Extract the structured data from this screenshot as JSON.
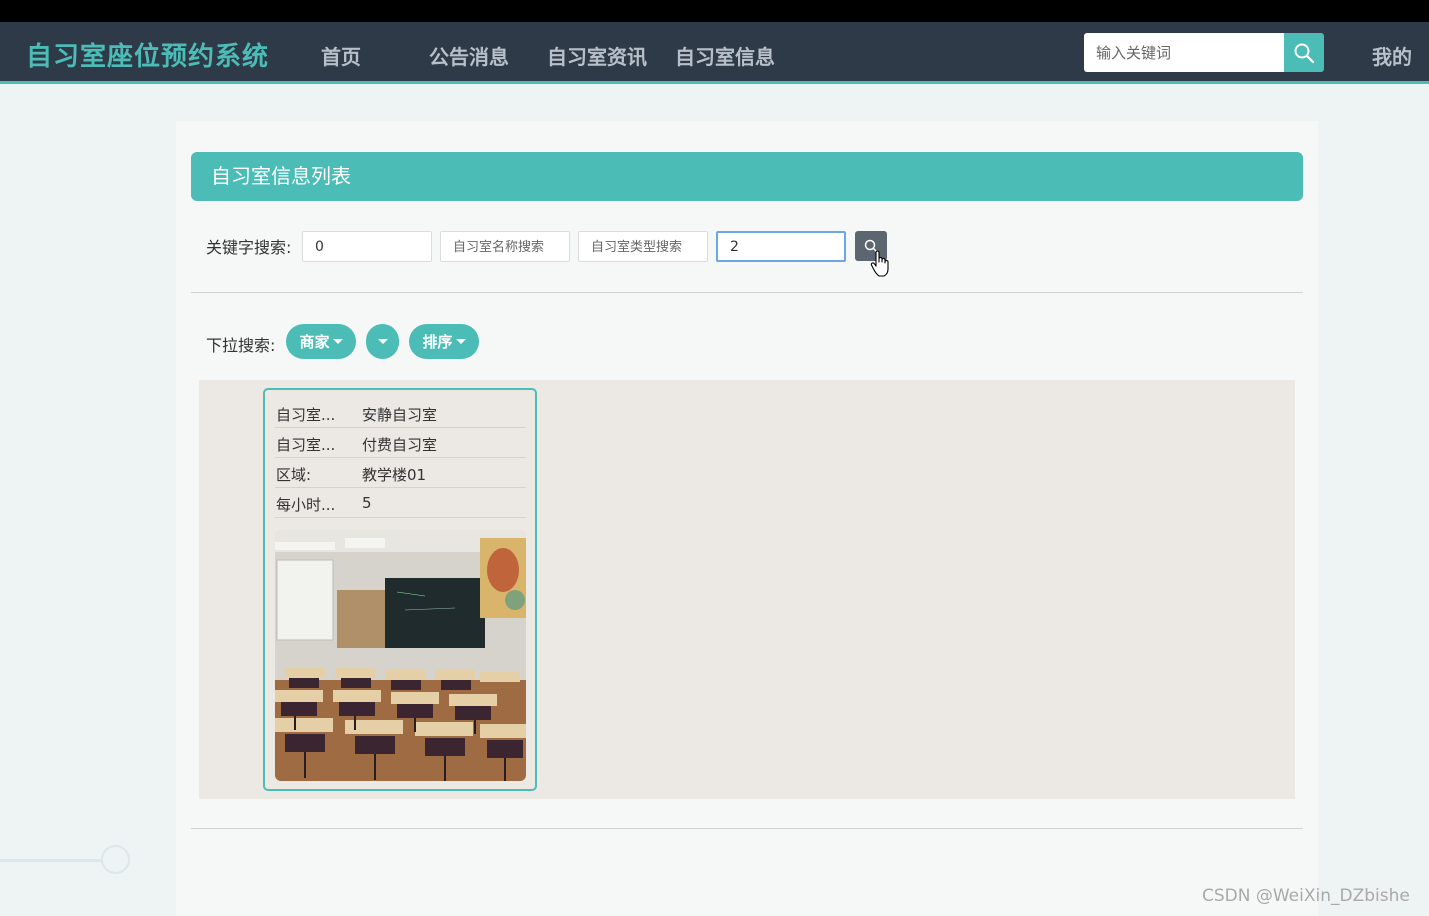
{
  "navbar": {
    "brand": "自习室座位预约系统",
    "links": [
      "首页",
      "公告消息",
      "自习室资讯",
      "自习室信息"
    ],
    "search_placeholder": "输入关键词",
    "mine": "我的"
  },
  "panel": {
    "title": "自习室信息列表",
    "search": {
      "label": "关键字搜索:",
      "field1_value": "0",
      "field2_placeholder": "自习室名称搜索",
      "field3_placeholder": "自习室类型搜索",
      "field4_value": "2"
    },
    "dropdowns": {
      "label": "下拉搜索:",
      "merchant": "商家",
      "sort": "排序"
    },
    "items": [
      {
        "rows": [
          {
            "key": "自习室...",
            "value": "安静自习室"
          },
          {
            "key": "自习室...",
            "value": "付费自习室"
          },
          {
            "key": "区域:",
            "value": "教学楼01"
          },
          {
            "key": "每小时...",
            "value": "5"
          }
        ]
      }
    ]
  },
  "watermark": "CSDN @WeiXin_DZbishe",
  "colors": {
    "accent": "#4bbcb6",
    "navbar": "#2e3a48"
  }
}
